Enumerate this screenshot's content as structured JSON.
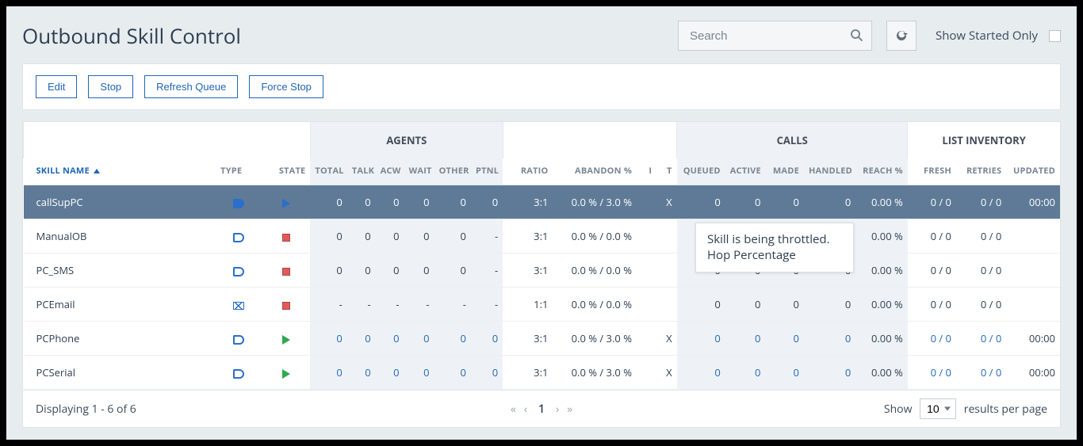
{
  "header": {
    "title": "Outbound Skill Control",
    "search_placeholder": "Search",
    "started_only_label": "Show Started Only"
  },
  "toolbar": {
    "edit": "Edit",
    "stop": "Stop",
    "refresh_queue": "Refresh Queue",
    "force_stop": "Force Stop"
  },
  "columns": {
    "skill_name": "SKILL NAME",
    "type": "TYPE",
    "state": "STATE",
    "total": "TOTAL",
    "talk": "TALK",
    "acw": "ACW",
    "wait": "WAIT",
    "other": "OTHER",
    "ptnl": "PTNL",
    "ratio": "RATIO",
    "abandon": "ABANDON %",
    "i": "I",
    "t": "T",
    "queued": "QUEUED",
    "active": "ACTIVE",
    "made": "MADE",
    "handled": "HANDLED",
    "reach": "REACH %",
    "fresh": "FRESH",
    "retries": "RETRIES",
    "updated": "UPDATED"
  },
  "groups": {
    "agents": "AGENTS",
    "calls": "CALLS",
    "list_inventory": "LIST INVENTORY"
  },
  "tooltip": {
    "line1": "Skill is being throttled.",
    "line2": "Hop Percentage"
  },
  "rows": [
    {
      "name": "callSupPC",
      "type_icon": "ob-solid",
      "state_icon": "play-blue",
      "total": "0",
      "talk": "0",
      "acw": "0",
      "wait": "0",
      "other": "0",
      "ptnl": "0",
      "ratio": "3:1",
      "abandon": "0.0 % / 3.0 %",
      "i": "",
      "t": "X",
      "queued": "0",
      "active": "0",
      "made": "0",
      "handled": "0",
      "reach": "0.00 %",
      "fresh": "0 / 0",
      "retries": "0 / 0",
      "updated": "00:00",
      "selected": true,
      "link": false
    },
    {
      "name": "ManualOB",
      "type_icon": "ob-outline",
      "state_icon": "stop-red",
      "total": "0",
      "talk": "0",
      "acw": "0",
      "wait": "0",
      "other": "0",
      "ptnl": "-",
      "ratio": "3:1",
      "abandon": "0.0 % / 0.0 %",
      "i": "",
      "t": "",
      "queued": "",
      "active": "",
      "made": "",
      "handled": "",
      "reach": "0.00 %",
      "fresh": "0 / 0",
      "retries": "0 / 0",
      "updated": "",
      "selected": false,
      "link": false
    },
    {
      "name": "PC_SMS",
      "type_icon": "ob-outline",
      "state_icon": "stop-red",
      "total": "0",
      "talk": "0",
      "acw": "0",
      "wait": "0",
      "other": "0",
      "ptnl": "-",
      "ratio": "3:1",
      "abandon": "0.0 % / 0.0 %",
      "i": "",
      "t": "",
      "queued": "0",
      "active": "0",
      "made": "0",
      "handled": "0",
      "reach": "0.00 %",
      "fresh": "0 / 0",
      "retries": "0 / 0",
      "updated": "",
      "selected": false,
      "link": false
    },
    {
      "name": "PCEmail",
      "type_icon": "mail",
      "state_icon": "stop-red",
      "total": "-",
      "talk": "-",
      "acw": "-",
      "wait": "-",
      "other": "-",
      "ptnl": "-",
      "ratio": "1:1",
      "abandon": "0.0 % / 0.0 %",
      "i": "",
      "t": "",
      "queued": "0",
      "active": "0",
      "made": "0",
      "handled": "0",
      "reach": "0.00 %",
      "fresh": "0 / 0",
      "retries": "0 / 0",
      "updated": "",
      "selected": false,
      "link": false
    },
    {
      "name": "PCPhone",
      "type_icon": "ob-outline",
      "state_icon": "play-green",
      "total": "0",
      "talk": "0",
      "acw": "0",
      "wait": "0",
      "other": "0",
      "ptnl": "0",
      "ratio": "3:1",
      "abandon": "0.0 % / 3.0 %",
      "i": "",
      "t": "X",
      "queued": "0",
      "active": "0",
      "made": "0",
      "handled": "0",
      "reach": "0.00 %",
      "fresh": "0 / 0",
      "retries": "0 / 0",
      "updated": "00:00",
      "selected": false,
      "link": true
    },
    {
      "name": "PCSerial",
      "type_icon": "ob-outline",
      "state_icon": "play-green",
      "total": "0",
      "talk": "0",
      "acw": "0",
      "wait": "0",
      "other": "0",
      "ptnl": "0",
      "ratio": "3:1",
      "abandon": "0.0 % / 3.0 %",
      "i": "",
      "t": "X",
      "queued": "0",
      "active": "0",
      "made": "0",
      "handled": "0",
      "reach": "0.00 %",
      "fresh": "0 / 0",
      "retries": "0 / 0",
      "updated": "00:00",
      "selected": false,
      "link": true
    }
  ],
  "footer": {
    "display_text": "Displaying 1 - 6 of 6",
    "page_current": "1",
    "show_label": "Show",
    "per_page_label": "results per page",
    "per_page_value": "10"
  }
}
